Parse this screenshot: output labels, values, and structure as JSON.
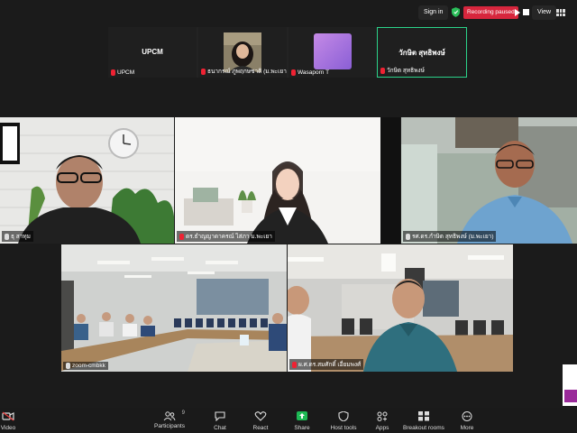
{
  "topbar": {
    "signin_label": "Sign in",
    "recording_label": "Recording paused",
    "view_label": "View"
  },
  "thumbnails": [
    {
      "display_name": "UPCM",
      "label": "UPCM",
      "muted": true
    },
    {
      "display_name": "",
      "label": "ธนากรณ์ ภูพฤกษชาติ (ม.พะเยา",
      "muted": true
    },
    {
      "display_name": "",
      "label": "Wasaporn T",
      "muted": true
    },
    {
      "display_name": "วักษิต สุทธิพงษ์",
      "label": "วักษิต สุทธิพงษ์",
      "muted": true
    }
  ],
  "tiles": [
    {
      "label": "ธุ สาทุม",
      "muted": false
    },
    {
      "label": "ดร.ธำญญาดาครณ์ ไส่ภา ม.พะเยา",
      "muted": true
    },
    {
      "label": "รศ.ดร.กำษิต สุทธิพงษ์ (ม.พะเยา)",
      "muted": false
    },
    {
      "label": "zoom-cmbkk",
      "muted": false
    },
    {
      "label": "ผ.ศ.ดร.สมศักดิ์ เอี่ยมพงศ์",
      "muted": true
    }
  ],
  "toolbar": {
    "video": "Video",
    "participants": "Participants",
    "participants_count": "9",
    "chat": "Chat",
    "react": "React",
    "share": "Share",
    "host_tools": "Host tools",
    "apps": "Apps",
    "breakout_rooms": "Breakout rooms",
    "more": "More"
  },
  "colors": {
    "recording": "#d7263d",
    "active_speaker": "#2bd38a",
    "share_green": "#1db954",
    "muted_red": "#e23b3b"
  }
}
